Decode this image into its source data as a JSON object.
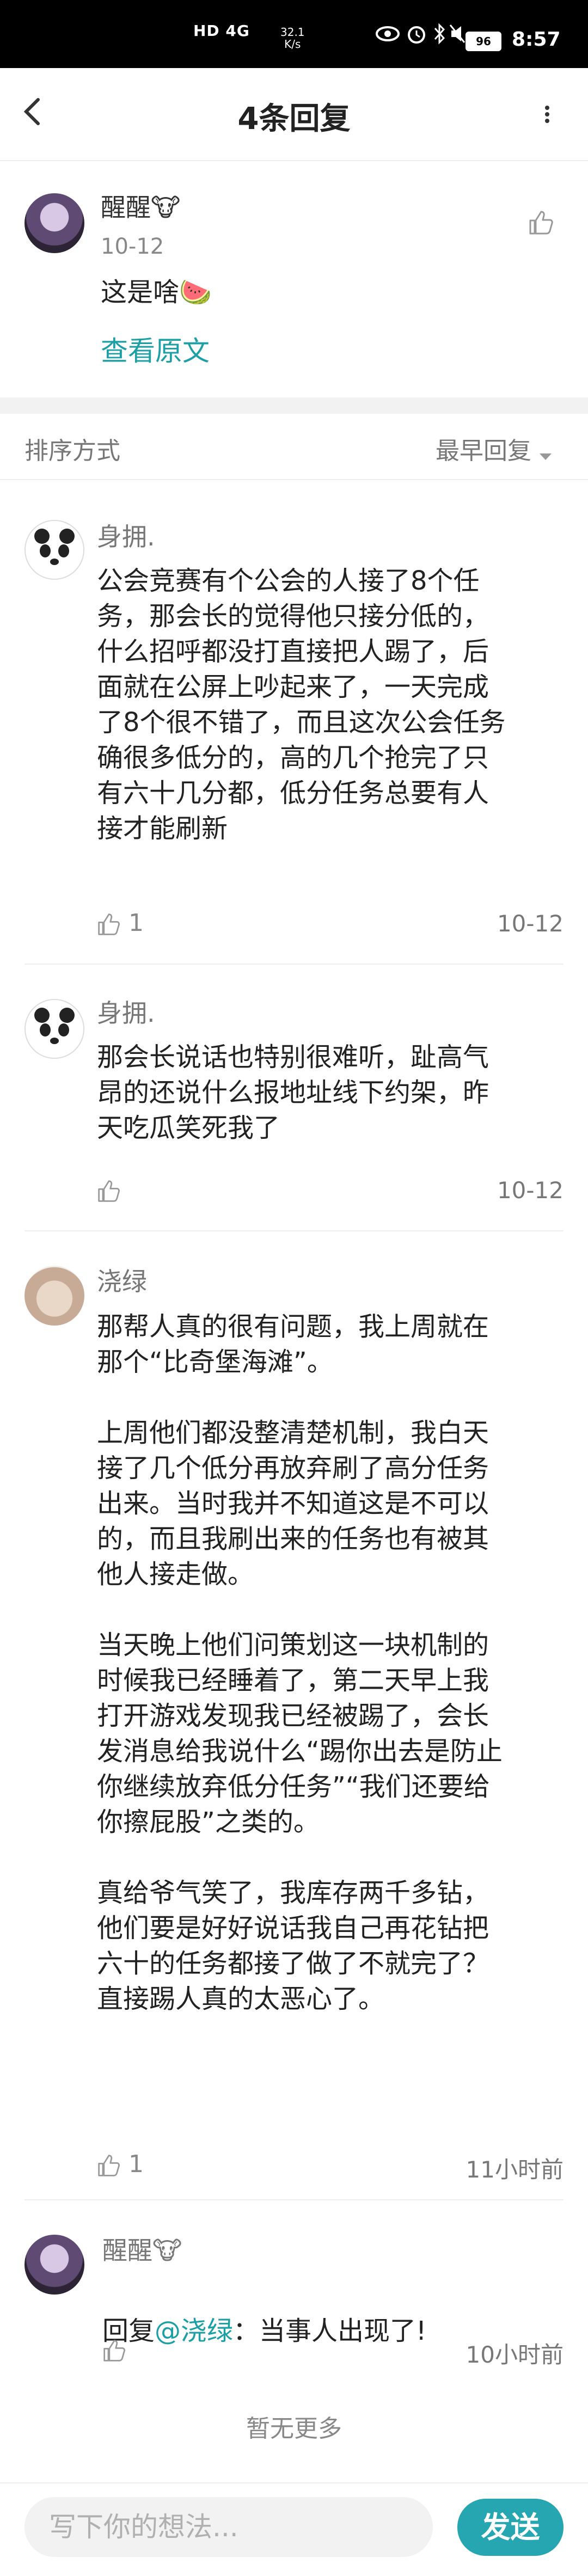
{
  "status_bar": {
    "network": "HD 4G",
    "speed_value": "32.1",
    "speed_unit": "K/s",
    "battery": "96",
    "time": "8:57"
  },
  "header": {
    "title": "4条回复"
  },
  "original_comment": {
    "author": "醒醒🐮",
    "date": "10-12",
    "text": "这是啥🍉",
    "view_original": "查看原文"
  },
  "sort": {
    "label": "排序方式",
    "value": "最早回复"
  },
  "replies": [
    {
      "author": "身拥.",
      "text": "公会竞赛有个公会的人接了8个任\n务，那会长的觉得他只接分低的，\n什么招呼都没打直接把人踢了，后\n面就在公屏上吵起来了，一天完成\n了8个很不错了，而且这次公会任务\n确很多低分的，高的几个抢完了只\n有六十几分都，低分任务总要有人\n接才能刷新",
      "likes": "1",
      "time": "10-12"
    },
    {
      "author": "身拥.",
      "text": "那会长说话也特别很难听，趾高气\n昂的还说什么报地址线下约架，昨\n天吃瓜笑死我了",
      "likes": "",
      "time": "10-12"
    },
    {
      "author": "浇绿",
      "text": "那帮人真的很有问题，我上周就在\n那个“比奇堡海滩”。\n\n上周他们都没整清楚机制，我白天\n接了几个低分再放弃刷了高分任务\n出来。当时我并不知道这是不可以\n的，而且我刷出来的任务也有被其\n他人接走做。\n\n当天晚上他们问策划这一块机制的\n时候我已经睡着了，第二天早上我\n打开游戏发现我已经被踢了，会长\n发消息给我说什么“踢你出去是防止\n你继续放弃低分任务”“我们还要给\n你擦屁股”之类的。\n\n真给爷气笑了，我库存两千多钻，\n他们要是好好说话我自己再花钻把\n六十的任务都接了做了不就完了？\n直接踢人真的太恶心了。",
      "likes": "1",
      "time": "11小时前"
    },
    {
      "author": "醒醒🐮",
      "reply_prefix": "回复",
      "mention": "@浇绿",
      "text": "：当事人出现了!",
      "likes": "",
      "time": "10小时前"
    }
  ],
  "footer": {
    "no_more": "暂无更多",
    "input_placeholder": "写下你的想法...",
    "send_label": "发送"
  },
  "colors": {
    "accent": "#25a6b0",
    "link": "#1d9fa6",
    "status_bar": "#000000"
  }
}
